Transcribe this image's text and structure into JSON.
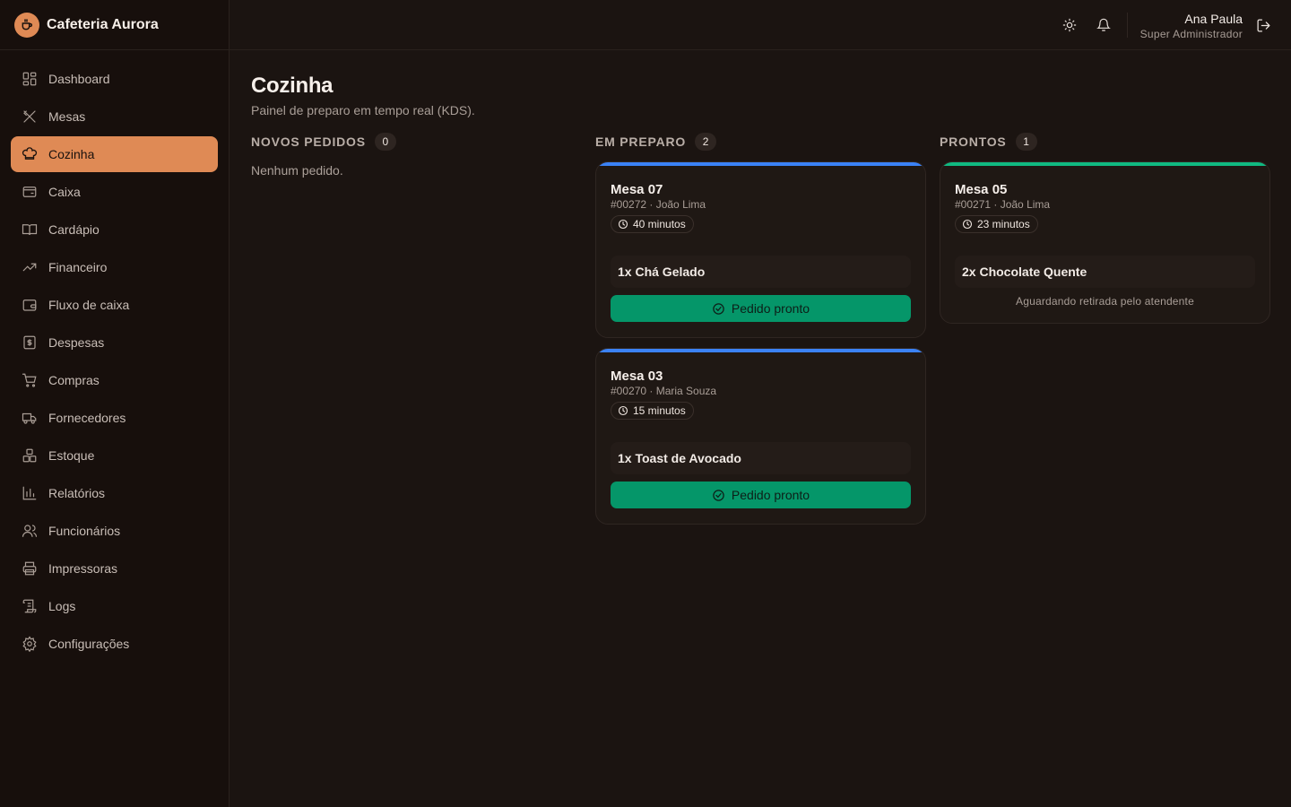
{
  "app": {
    "name": "Cafeteria Aurora"
  },
  "sidebar": {
    "items": [
      {
        "label": "Dashboard",
        "icon": "dashboard-icon"
      },
      {
        "label": "Mesas",
        "icon": "utensils-icon"
      },
      {
        "label": "Cozinha",
        "icon": "chef-hat-icon",
        "active": true
      },
      {
        "label": "Caixa",
        "icon": "register-icon"
      },
      {
        "label": "Cardápio",
        "icon": "book-icon"
      },
      {
        "label": "Financeiro",
        "icon": "trending-up-icon"
      },
      {
        "label": "Fluxo de caixa",
        "icon": "wallet-icon"
      },
      {
        "label": "Despesas",
        "icon": "receipt-icon"
      },
      {
        "label": "Compras",
        "icon": "cart-icon"
      },
      {
        "label": "Fornecedores",
        "icon": "truck-icon"
      },
      {
        "label": "Estoque",
        "icon": "boxes-icon"
      },
      {
        "label": "Relatórios",
        "icon": "bar-chart-icon"
      },
      {
        "label": "Funcionários",
        "icon": "users-icon"
      },
      {
        "label": "Impressoras",
        "icon": "printer-icon"
      },
      {
        "label": "Logs",
        "icon": "scroll-icon"
      },
      {
        "label": "Configurações",
        "icon": "gear-icon"
      }
    ]
  },
  "header": {
    "user_name": "Ana Paula",
    "user_role": "Super Administrador"
  },
  "page": {
    "title": "Cozinha",
    "subtitle": "Painel de preparo em tempo real (KDS)."
  },
  "columns": {
    "new": {
      "title": "NOVOS PEDIDOS",
      "count": "0",
      "empty_text": "Nenhum pedido."
    },
    "preparing": {
      "title": "EM PREPARO",
      "count": "2",
      "accent": "#3b82f6",
      "orders": [
        {
          "table": "Mesa 07",
          "meta": "#00272 · João Lima",
          "time": "40 minutos",
          "items": [
            "1x Chá Gelado"
          ],
          "button": "Pedido pronto"
        },
        {
          "table": "Mesa 03",
          "meta": "#00270 · Maria Souza",
          "time": "15 minutos",
          "items": [
            "1x Toast de Avocado"
          ],
          "button": "Pedido pronto"
        }
      ]
    },
    "ready": {
      "title": "PRONTOS",
      "count": "1",
      "accent": "#10b981",
      "orders": [
        {
          "table": "Mesa 05",
          "meta": "#00271 · João Lima",
          "time": "23 minutos",
          "items": [
            "2x Chocolate Quente"
          ],
          "status": "Aguardando retirada pelo atendente"
        }
      ]
    }
  },
  "colors": {
    "primary": "#df8a55",
    "success": "#059669",
    "background": "#1b1411"
  }
}
